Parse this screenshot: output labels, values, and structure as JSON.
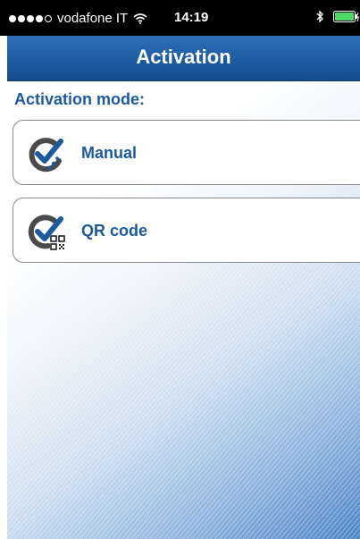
{
  "status_bar": {
    "carrier": "vodafone IT",
    "time": "14:19",
    "signal_strength": "4 of 5",
    "signal_icon": "signal-dots-icon",
    "wifi_icon": "wifi-icon",
    "bluetooth_icon": "bluetooth-icon",
    "battery_icon": "battery-charging-icon"
  },
  "nav_bar": {
    "title": "Activation"
  },
  "main": {
    "section_label": "Activation mode:",
    "options": [
      {
        "label": "Manual",
        "icon": "manual-activation-icon"
      },
      {
        "label": "QR code",
        "icon": "qr-activation-icon"
      }
    ]
  },
  "colors": {
    "nav_bar": "#1b5aa0",
    "accent_text": "#1b5aa0",
    "icon_grey": "#4a4a4a",
    "status_bar": "#000000",
    "battery": "#4cd964"
  }
}
